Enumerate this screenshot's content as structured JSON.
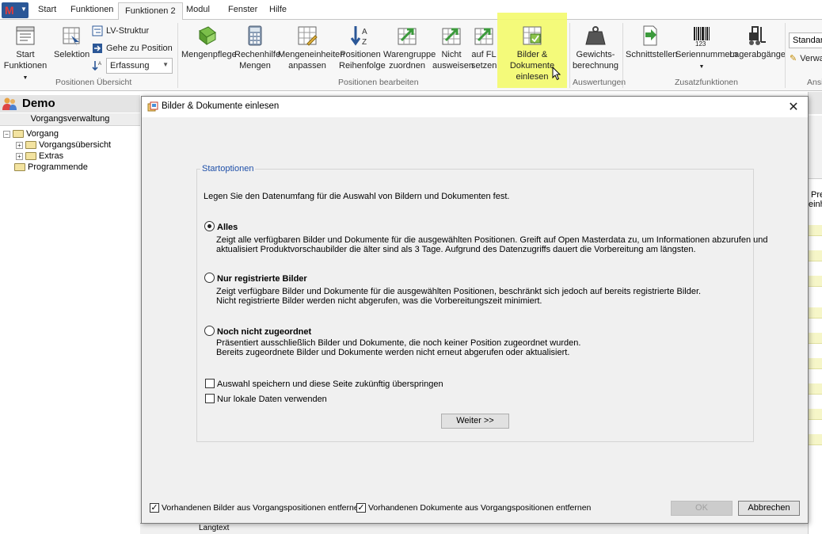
{
  "ribbon_tabs": [
    "Start",
    "Funktionen",
    "Funktionen 2",
    "Modul",
    "Fenster",
    "Hilfe"
  ],
  "ribbon": {
    "groups": {
      "positionen_uebersicht": "Positionen Übersicht",
      "positionen_bearbeiten": "Positionen bearbeiten",
      "auswertungen": "Auswertungen",
      "zusatzfunktionen": "Zusatzfunktionen",
      "ansi": "Ansi"
    },
    "buttons": {
      "start_funktionen_1": "Start",
      "start_funktionen_2": "Funktionen",
      "selektion": "Selektion",
      "lv_struktur": "LV-Struktur",
      "gehe_zu_position": "Gehe zu Position",
      "erfassung": "Erfassung",
      "mengenpflege": "Mengenpflege",
      "rechenhilfe_1": "Rechenhilfe",
      "rechenhilfe_2": "Mengen",
      "mengeneinheiten_1": "Mengeneinheiten",
      "mengeneinheiten_2": "anpassen",
      "positionen_1": "Positionen",
      "positionen_2": "Reihenfolge",
      "warengruppe_1": "Warengruppe",
      "warengruppe_2": "zuordnen",
      "nicht_1": "Nicht",
      "nicht_2": "ausweisen",
      "auf_fl_1": "auf FL",
      "auf_fl_2": "setzen",
      "bilder_1": "Bilder & Dokumente",
      "bilder_2": "einlesen",
      "gewichts_1": "Gewichts-",
      "gewichts_2": "berechnung",
      "schnittstellen": "Schnittstellen",
      "seriennummern": "Seriennummern",
      "lagerabgaenge": "Lagerabgänge",
      "standard": "Standard",
      "verwa": "Verwa"
    }
  },
  "left_panel": {
    "title": "Demo",
    "section": "Vorgangsverwaltung",
    "tree": [
      "Vorgang",
      "Vorgangsübersicht",
      "Extras",
      "Programmende"
    ]
  },
  "background": {
    "right_col_1": "Pre",
    "right_col_2": "einh",
    "bottom_field": "Langtext"
  },
  "dialog": {
    "title": "Bilder & Dokumente einlesen",
    "group_title": "Startoptionen",
    "intro": "Legen Sie den Datenumfang für die Auswahl von Bildern und Dokumenten fest.",
    "options": [
      {
        "title": "Alles",
        "line1": "Zeigt alle verfügbaren Bilder und Dokumente für die ausgewählten Positionen. Greift auf Open Masterdata zu, um Informationen abzurufen und",
        "line2": "aktualisiert Produktvorschaubilder die älter sind als 3 Tage. Aufgrund des Datenzugriffs dauert die Vorbereitung am längsten."
      },
      {
        "title": "Nur registrierte Bilder",
        "line1": "Zeigt verfügbare Bilder und Dokumente für die ausgewählten Positionen, beschränkt sich jedoch auf bereits registrierte Bilder.",
        "line2": "Nicht registrierte Bilder werden nicht abgerufen, was die Vorbereitungszeit minimiert."
      },
      {
        "title": "Noch nicht zugeordnet",
        "line1": "Präsentiert ausschließlich Bilder und Dokumente, die noch keiner Position zugeordnet wurden.",
        "line2": "Bereits zugeordnete Bilder und Dokumente werden nicht erneut abgerufen oder aktualisiert."
      }
    ],
    "selected_option": "Alles",
    "checkbox_skip": "Auswahl speichern und diese Seite zukünftig überspringen",
    "checkbox_local": "Nur lokale Daten verwenden",
    "weiter_label": "Weiter >>",
    "footer_check_bilder": "Vorhandenen Bilder aus Vorgangspositionen entfernen",
    "footer_check_dokumente": "Vorhandenen Dokumente aus Vorgangspositionen entfernen",
    "ok_label": "OK",
    "cancel_label": "Abbrechen"
  },
  "colors": {
    "highlight": "#f3f96c",
    "legend_blue": "#1e4fa8",
    "app_button": "#2b5797"
  }
}
